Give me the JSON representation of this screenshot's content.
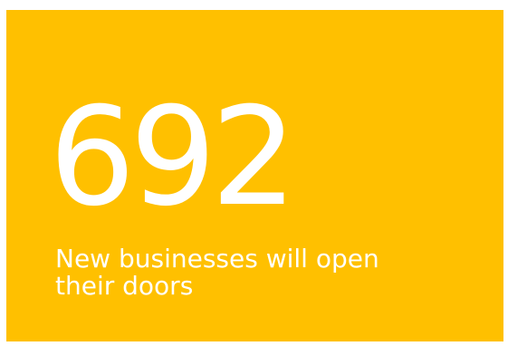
{
  "card": {
    "background_color": "#ffc000",
    "text_color": "#ffffff",
    "stat_value": "692",
    "caption_line1": "New businesses will open",
    "caption_line2": "their doors"
  }
}
